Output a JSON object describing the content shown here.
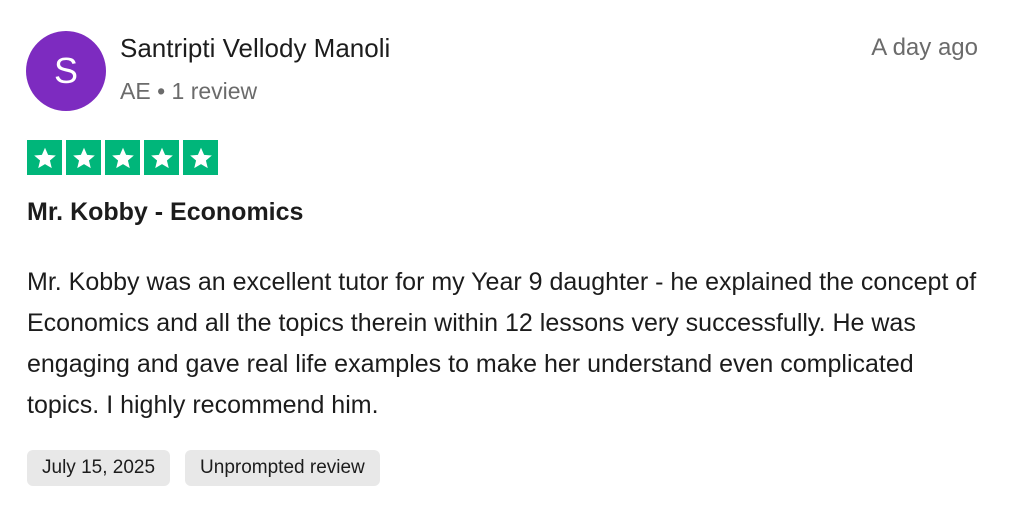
{
  "reviewer": {
    "initial": "S",
    "name": "Santripti Vellody Manoli",
    "meta": "AE • 1 review",
    "avatar_color": "#7d2bc0"
  },
  "review": {
    "age": "A day ago",
    "rating": 5,
    "max_rating": 5,
    "star_color": "#00b67a",
    "title": "Mr. Kobby - Economics",
    "body": "Mr. Kobby was an excellent tutor for my Year 9 daughter - he explained the concept of Economics and all the topics therein within 12 lessons very successfully. He was engaging and gave real life examples to make her understand even complicated topics. I highly recommend him.",
    "tags": {
      "date": "July 15, 2025",
      "type": "Unprompted review"
    }
  }
}
